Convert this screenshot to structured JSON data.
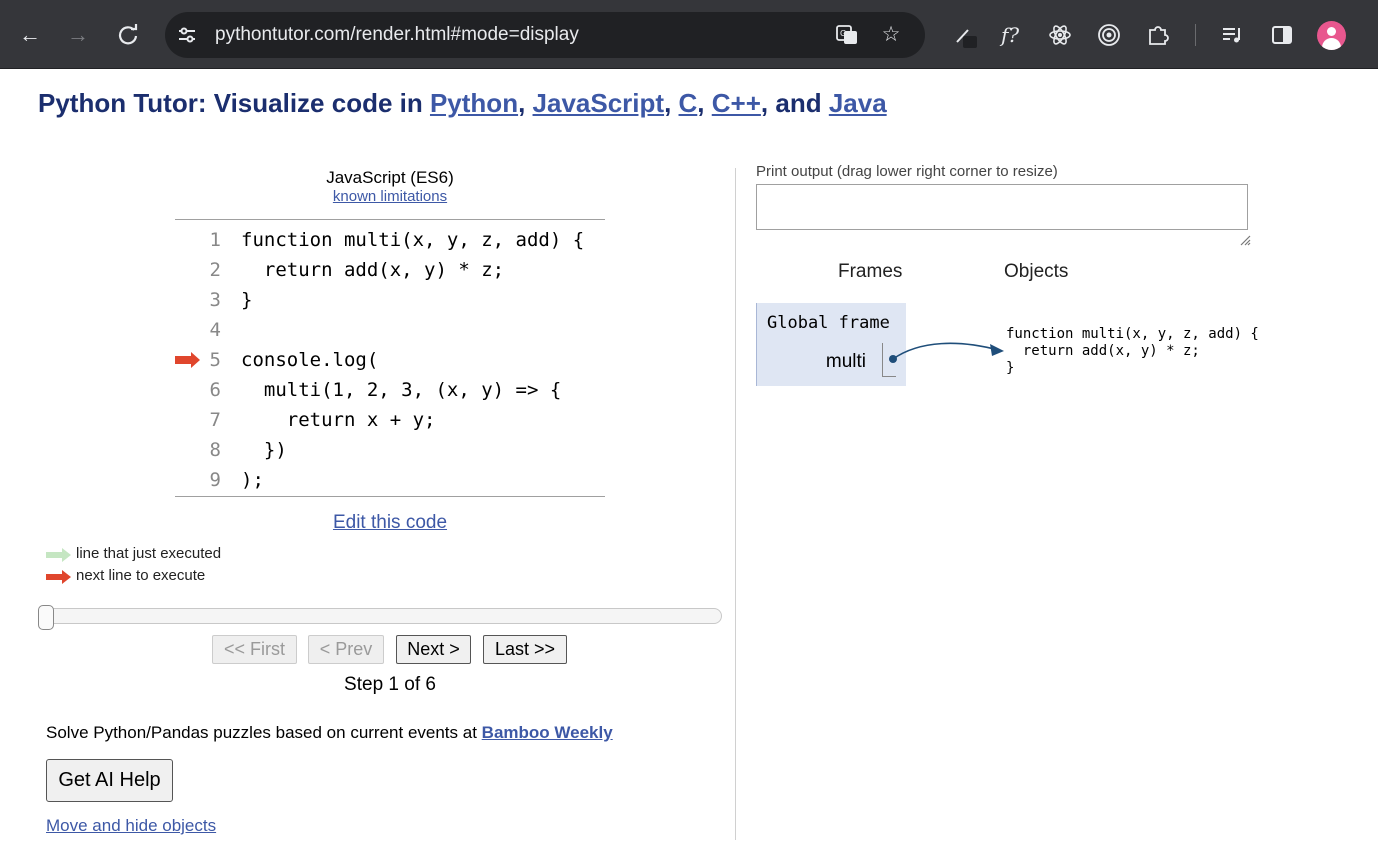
{
  "browser": {
    "url": "pythontutor.com/render.html#mode=display"
  },
  "page": {
    "title_prefix": "Python Tutor: Visualize code in ",
    "languages": [
      "Python",
      "JavaScript",
      "C",
      "C++",
      "Java"
    ],
    "sep_comma": ", ",
    "sep_and": ", and "
  },
  "editor": {
    "language_label": "JavaScript (ES6)",
    "limitations_link": "known limitations",
    "lines": [
      {
        "n": "1",
        "code": "function multi(x, y, z, add) {"
      },
      {
        "n": "2",
        "code": "  return add(x, y) * z;"
      },
      {
        "n": "3",
        "code": "}"
      },
      {
        "n": "4",
        "code": ""
      },
      {
        "n": "5",
        "code": "console.log("
      },
      {
        "n": "6",
        "code": "  multi(1, 2, 3, (x, y) => {"
      },
      {
        "n": "7",
        "code": "    return x + y;"
      },
      {
        "n": "8",
        "code": "  })"
      },
      {
        "n": "9",
        "code": ");"
      }
    ],
    "next_line": 5,
    "edit_link": "Edit this code"
  },
  "legend": {
    "executed": "line that just executed",
    "next": "next line to execute",
    "executed_color": "#c5e6c2",
    "next_color": "#e0462d"
  },
  "navigation": {
    "first": "<< First",
    "prev": "< Prev",
    "next": "Next >",
    "last": "Last >>",
    "step_label": "Step 1 of 6",
    "progress_fraction": 0
  },
  "promo": {
    "text": "Solve Python/Pandas puzzles based on current events at ",
    "link": "Bamboo Weekly"
  },
  "ai_help": "Get AI Help",
  "move_hide": "Move and hide objects",
  "output": {
    "label": "Print output (drag lower right corner to resize)",
    "value": ""
  },
  "viz": {
    "frames_header": "Frames",
    "objects_header": "Objects",
    "global_frame": "Global frame",
    "var_name": "multi",
    "function_text": "function multi(x, y, z, add) {\n  return add(x, y) * z;\n}"
  }
}
